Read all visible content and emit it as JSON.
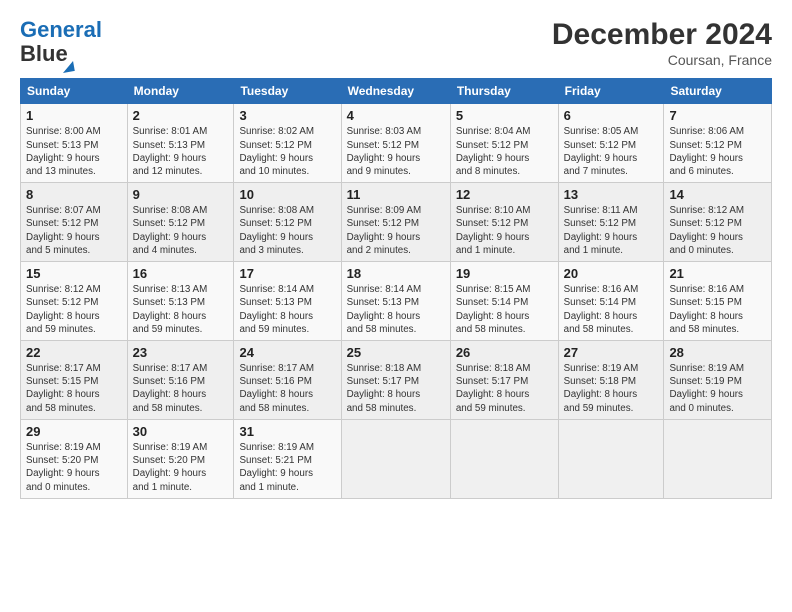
{
  "logo": {
    "line1": "General",
    "line2": "Blue"
  },
  "title": "December 2024",
  "subtitle": "Coursan, France",
  "days_of_week": [
    "Sunday",
    "Monday",
    "Tuesday",
    "Wednesday",
    "Thursday",
    "Friday",
    "Saturday"
  ],
  "weeks": [
    [
      {
        "day": "1",
        "info": "Sunrise: 8:00 AM\nSunset: 5:13 PM\nDaylight: 9 hours\nand 13 minutes."
      },
      {
        "day": "2",
        "info": "Sunrise: 8:01 AM\nSunset: 5:13 PM\nDaylight: 9 hours\nand 12 minutes."
      },
      {
        "day": "3",
        "info": "Sunrise: 8:02 AM\nSunset: 5:12 PM\nDaylight: 9 hours\nand 10 minutes."
      },
      {
        "day": "4",
        "info": "Sunrise: 8:03 AM\nSunset: 5:12 PM\nDaylight: 9 hours\nand 9 minutes."
      },
      {
        "day": "5",
        "info": "Sunrise: 8:04 AM\nSunset: 5:12 PM\nDaylight: 9 hours\nand 8 minutes."
      },
      {
        "day": "6",
        "info": "Sunrise: 8:05 AM\nSunset: 5:12 PM\nDaylight: 9 hours\nand 7 minutes."
      },
      {
        "day": "7",
        "info": "Sunrise: 8:06 AM\nSunset: 5:12 PM\nDaylight: 9 hours\nand 6 minutes."
      }
    ],
    [
      {
        "day": "8",
        "info": "Sunrise: 8:07 AM\nSunset: 5:12 PM\nDaylight: 9 hours\nand 5 minutes."
      },
      {
        "day": "9",
        "info": "Sunrise: 8:08 AM\nSunset: 5:12 PM\nDaylight: 9 hours\nand 4 minutes."
      },
      {
        "day": "10",
        "info": "Sunrise: 8:08 AM\nSunset: 5:12 PM\nDaylight: 9 hours\nand 3 minutes."
      },
      {
        "day": "11",
        "info": "Sunrise: 8:09 AM\nSunset: 5:12 PM\nDaylight: 9 hours\nand 2 minutes."
      },
      {
        "day": "12",
        "info": "Sunrise: 8:10 AM\nSunset: 5:12 PM\nDaylight: 9 hours\nand 1 minute."
      },
      {
        "day": "13",
        "info": "Sunrise: 8:11 AM\nSunset: 5:12 PM\nDaylight: 9 hours\nand 1 minute."
      },
      {
        "day": "14",
        "info": "Sunrise: 8:12 AM\nSunset: 5:12 PM\nDaylight: 9 hours\nand 0 minutes."
      }
    ],
    [
      {
        "day": "15",
        "info": "Sunrise: 8:12 AM\nSunset: 5:12 PM\nDaylight: 8 hours\nand 59 minutes."
      },
      {
        "day": "16",
        "info": "Sunrise: 8:13 AM\nSunset: 5:13 PM\nDaylight: 8 hours\nand 59 minutes."
      },
      {
        "day": "17",
        "info": "Sunrise: 8:14 AM\nSunset: 5:13 PM\nDaylight: 8 hours\nand 59 minutes."
      },
      {
        "day": "18",
        "info": "Sunrise: 8:14 AM\nSunset: 5:13 PM\nDaylight: 8 hours\nand 58 minutes."
      },
      {
        "day": "19",
        "info": "Sunrise: 8:15 AM\nSunset: 5:14 PM\nDaylight: 8 hours\nand 58 minutes."
      },
      {
        "day": "20",
        "info": "Sunrise: 8:16 AM\nSunset: 5:14 PM\nDaylight: 8 hours\nand 58 minutes."
      },
      {
        "day": "21",
        "info": "Sunrise: 8:16 AM\nSunset: 5:15 PM\nDaylight: 8 hours\nand 58 minutes."
      }
    ],
    [
      {
        "day": "22",
        "info": "Sunrise: 8:17 AM\nSunset: 5:15 PM\nDaylight: 8 hours\nand 58 minutes."
      },
      {
        "day": "23",
        "info": "Sunrise: 8:17 AM\nSunset: 5:16 PM\nDaylight: 8 hours\nand 58 minutes."
      },
      {
        "day": "24",
        "info": "Sunrise: 8:17 AM\nSunset: 5:16 PM\nDaylight: 8 hours\nand 58 minutes."
      },
      {
        "day": "25",
        "info": "Sunrise: 8:18 AM\nSunset: 5:17 PM\nDaylight: 8 hours\nand 58 minutes."
      },
      {
        "day": "26",
        "info": "Sunrise: 8:18 AM\nSunset: 5:17 PM\nDaylight: 8 hours\nand 59 minutes."
      },
      {
        "day": "27",
        "info": "Sunrise: 8:19 AM\nSunset: 5:18 PM\nDaylight: 8 hours\nand 59 minutes."
      },
      {
        "day": "28",
        "info": "Sunrise: 8:19 AM\nSunset: 5:19 PM\nDaylight: 9 hours\nand 0 minutes."
      }
    ],
    [
      {
        "day": "29",
        "info": "Sunrise: 8:19 AM\nSunset: 5:20 PM\nDaylight: 9 hours\nand 0 minutes."
      },
      {
        "day": "30",
        "info": "Sunrise: 8:19 AM\nSunset: 5:20 PM\nDaylight: 9 hours\nand 1 minute."
      },
      {
        "day": "31",
        "info": "Sunrise: 8:19 AM\nSunset: 5:21 PM\nDaylight: 9 hours\nand 1 minute."
      },
      null,
      null,
      null,
      null
    ]
  ]
}
